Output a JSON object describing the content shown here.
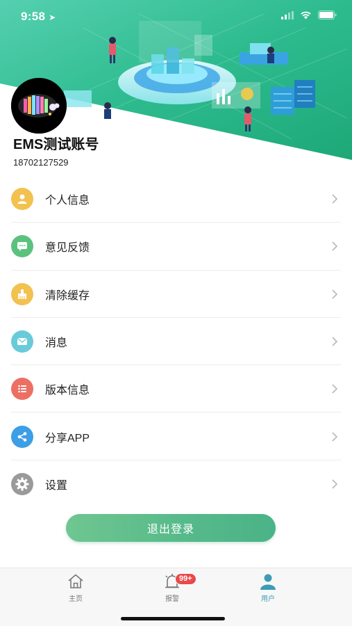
{
  "status_bar": {
    "time": "9:58"
  },
  "profile": {
    "name": "EMS测试账号",
    "phone": "18702127529"
  },
  "menu": {
    "items": [
      {
        "label": "个人信息",
        "icon": "person-icon",
        "color": "#f2c14f"
      },
      {
        "label": "意见反馈",
        "icon": "chat-bubble-icon",
        "color": "#5bc27e"
      },
      {
        "label": "清除缓存",
        "icon": "broom-icon",
        "color": "#f2c14f"
      },
      {
        "label": "消息",
        "icon": "envelope-icon",
        "color": "#69cbd9"
      },
      {
        "label": "版本信息",
        "icon": "list-icon",
        "color": "#ec6f63"
      },
      {
        "label": "分享APP",
        "icon": "share-icon",
        "color": "#3d9ee6"
      },
      {
        "label": "设置",
        "icon": "gear-icon",
        "color": "#9a9a9a"
      }
    ]
  },
  "logout": {
    "label": "退出登录"
  },
  "tabbar": {
    "tabs": [
      {
        "label": "主页",
        "icon": "home-icon"
      },
      {
        "label": "报警",
        "icon": "alarm-bell-icon",
        "badge": "99+"
      },
      {
        "label": "用户",
        "icon": "user-icon",
        "active": true
      }
    ]
  },
  "colors": {
    "brand_green": "#3fbf86",
    "header_gradient_start": "#43c8a3",
    "header_gradient_end": "#1fae7e",
    "active_tab": "#3e9bb5"
  }
}
